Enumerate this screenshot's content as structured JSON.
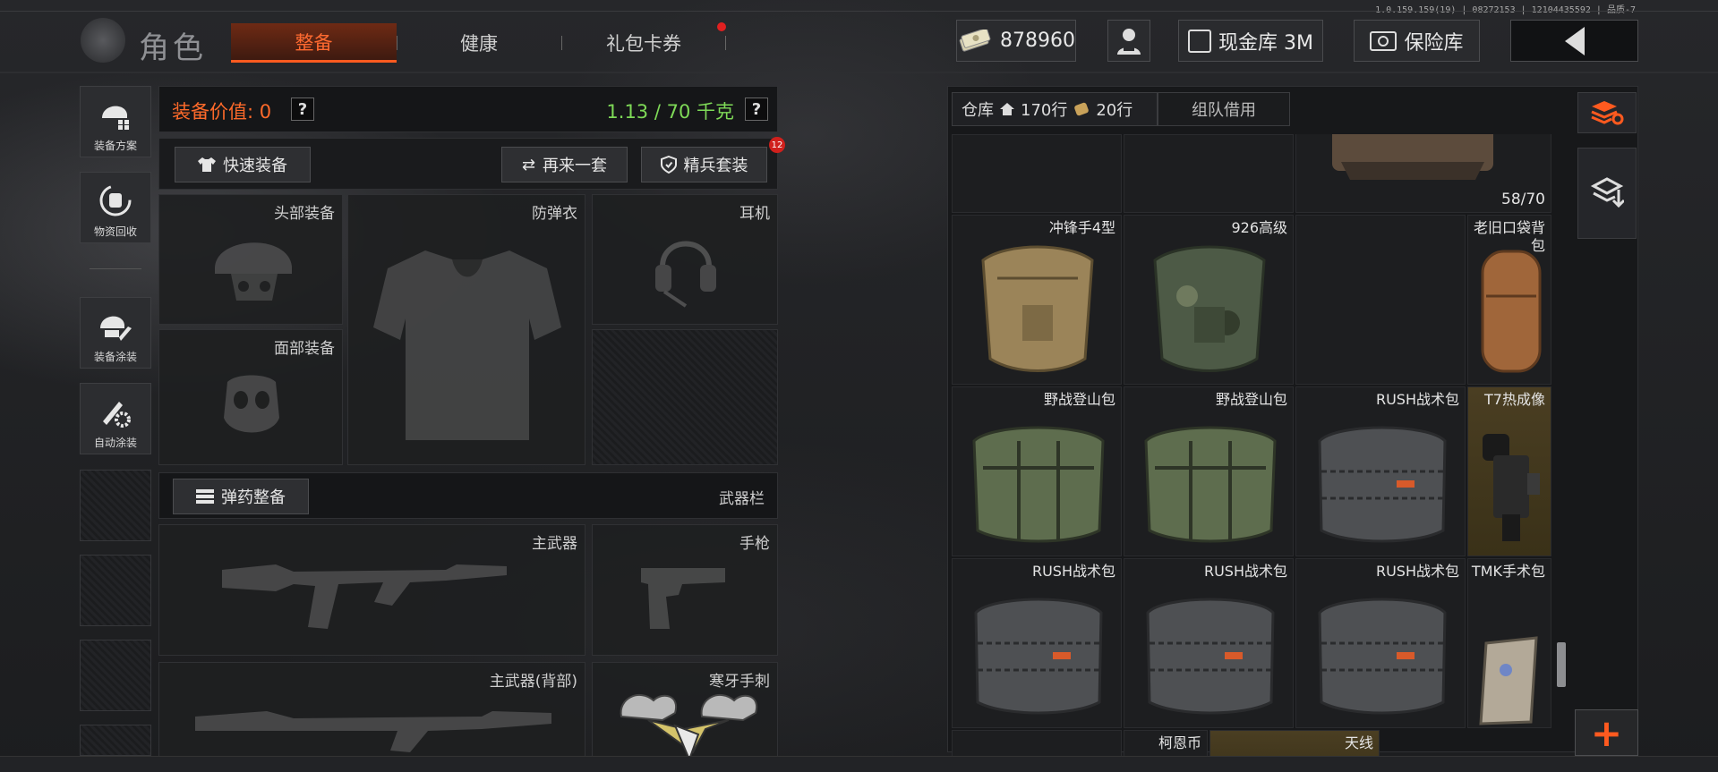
{
  "build_info": "1.0.159.159(19) | 08272153 | 12104435592 | 品质-7",
  "header": {
    "title": "角色",
    "tabs": [
      {
        "label": "整备",
        "active": true
      },
      {
        "label": "健康",
        "active": false
      },
      {
        "label": "礼包卡券",
        "active": false,
        "notify_dot": true
      }
    ],
    "currency_value": "878960",
    "cash_vault_label": "现金库 3M",
    "safe_label": "保险库"
  },
  "rail": {
    "buttons": [
      {
        "label": "装备方案",
        "icon": "helmet-grid-icon"
      },
      {
        "label": "物资回收",
        "icon": "recycle-bag-icon"
      },
      {
        "label": "装备涂装",
        "icon": "helmet-brush-icon"
      },
      {
        "label": "自动涂装",
        "icon": "brush-gear-icon"
      }
    ]
  },
  "equip": {
    "value_label": "装备价值: 0",
    "help": "?",
    "weight_label": "1.13 / 70 千克",
    "quick_equip": "快速装备",
    "redo_set": "再来一套",
    "elite_set": "精兵套装",
    "elite_badge": "12",
    "slots": {
      "head": "头部装备",
      "armor": "防弹衣",
      "headset": "耳机",
      "face": "面部装备",
      "ammo_btn": "弹药整备",
      "weapon_bar": "武器栏",
      "primary": "主武器",
      "pistol": "手枪",
      "primary_back": "主武器(背部)",
      "melee": "寒牙手刺"
    }
  },
  "storage": {
    "tab_warehouse": "仓库",
    "rows_home": "170行",
    "rows_bag": "20行",
    "tab_team": "组队借用",
    "top_count": "58/70",
    "items": [
      {
        "label": "冲锋手4型",
        "kind": "pouch-tan"
      },
      {
        "label": "926高级",
        "kind": "pouch-camo"
      },
      {
        "label": "",
        "kind": "empty"
      },
      {
        "label": "老旧口袋背包",
        "kind": "duffel"
      },
      {
        "label": "野战登山包",
        "kind": "green-bag"
      },
      {
        "label": "野战登山包",
        "kind": "green-bag"
      },
      {
        "label": "RUSH战术包",
        "kind": "rush-bag"
      },
      {
        "label": "T7热成像",
        "kind": "thermal"
      },
      {
        "label": "RUSH战术包",
        "kind": "rush-bag"
      },
      {
        "label": "RUSH战术包",
        "kind": "rush-bag"
      },
      {
        "label": "RUSH战术包",
        "kind": "rush-bag"
      },
      {
        "label": "TMK手术包",
        "kind": "med-bag"
      },
      {
        "label": "柯恩币",
        "kind": "coin"
      },
      {
        "label": "天线",
        "kind": "antenna"
      }
    ]
  },
  "colors": {
    "accent": "#ff5a1f",
    "weight_ok": "#7ed957",
    "value_orange": "#ff6a2a",
    "rare_gold": "#4a3e22"
  }
}
